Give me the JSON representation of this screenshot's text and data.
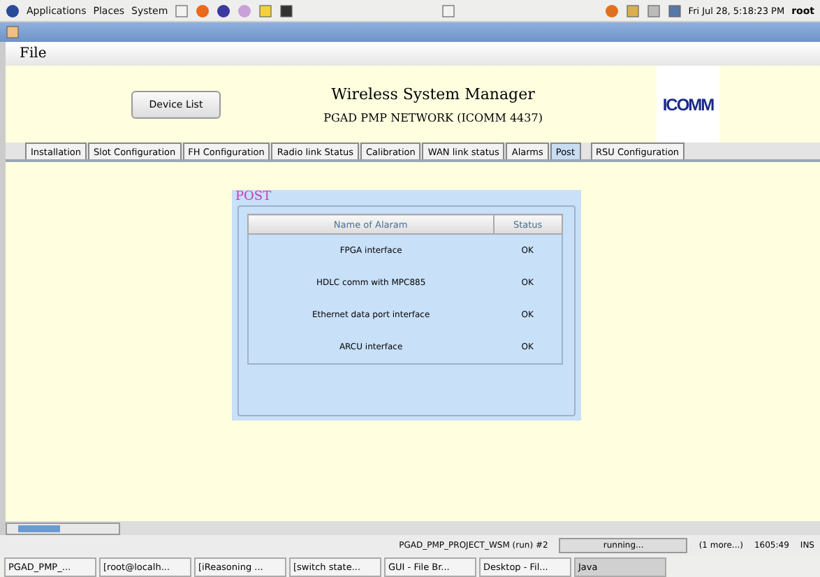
{
  "top_panel": {
    "menus": [
      "Applications",
      "Places",
      "System"
    ],
    "clock": "Fri Jul 28,  5:18:23 PM",
    "user": "root"
  },
  "menubar": [
    "File"
  ],
  "header": {
    "button": "Device List",
    "title": "Wireless System Manager",
    "subtitle": "PGAD PMP NETWORK (ICOMM 4437)",
    "logo": "ICOMM"
  },
  "tabs": [
    {
      "label": "Installation",
      "selected": false
    },
    {
      "label": "Slot Configuration",
      "selected": false
    },
    {
      "label": "FH Configuration",
      "selected": false
    },
    {
      "label": "Radio link Status",
      "selected": false
    },
    {
      "label": "Calibration",
      "selected": false
    },
    {
      "label": "WAN link status",
      "selected": false
    },
    {
      "label": "Alarms",
      "selected": false
    },
    {
      "label": "Post",
      "selected": true
    },
    {
      "label": "RSU Configuration",
      "selected": false
    }
  ],
  "post": {
    "title": "POST",
    "columns": [
      "Name of Alaram",
      "Status"
    ],
    "rows": [
      [
        "FPGA interface",
        "OK"
      ],
      [
        "HDLC comm with MPC885",
        "OK"
      ],
      [
        "Ethernet data port interface",
        "OK"
      ],
      [
        "ARCU interface",
        "OK"
      ]
    ]
  },
  "status_bar": {
    "project": "PGAD_PMP_PROJECT_WSM (run) #2",
    "progress": "running...",
    "more": "(1 more...)",
    "position": "1605:49",
    "mode": "INS"
  },
  "taskbar": [
    {
      "label": "PGAD_PMP_...",
      "selected": false
    },
    {
      "label": "[root@localh...",
      "selected": false
    },
    {
      "label": "[iReasoning ...",
      "selected": false
    },
    {
      "label": "[switch state...",
      "selected": false
    },
    {
      "label": "GUI - File Br...",
      "selected": false
    },
    {
      "label": "Desktop - Fil...",
      "selected": false
    },
    {
      "label": "Java",
      "selected": true
    }
  ]
}
